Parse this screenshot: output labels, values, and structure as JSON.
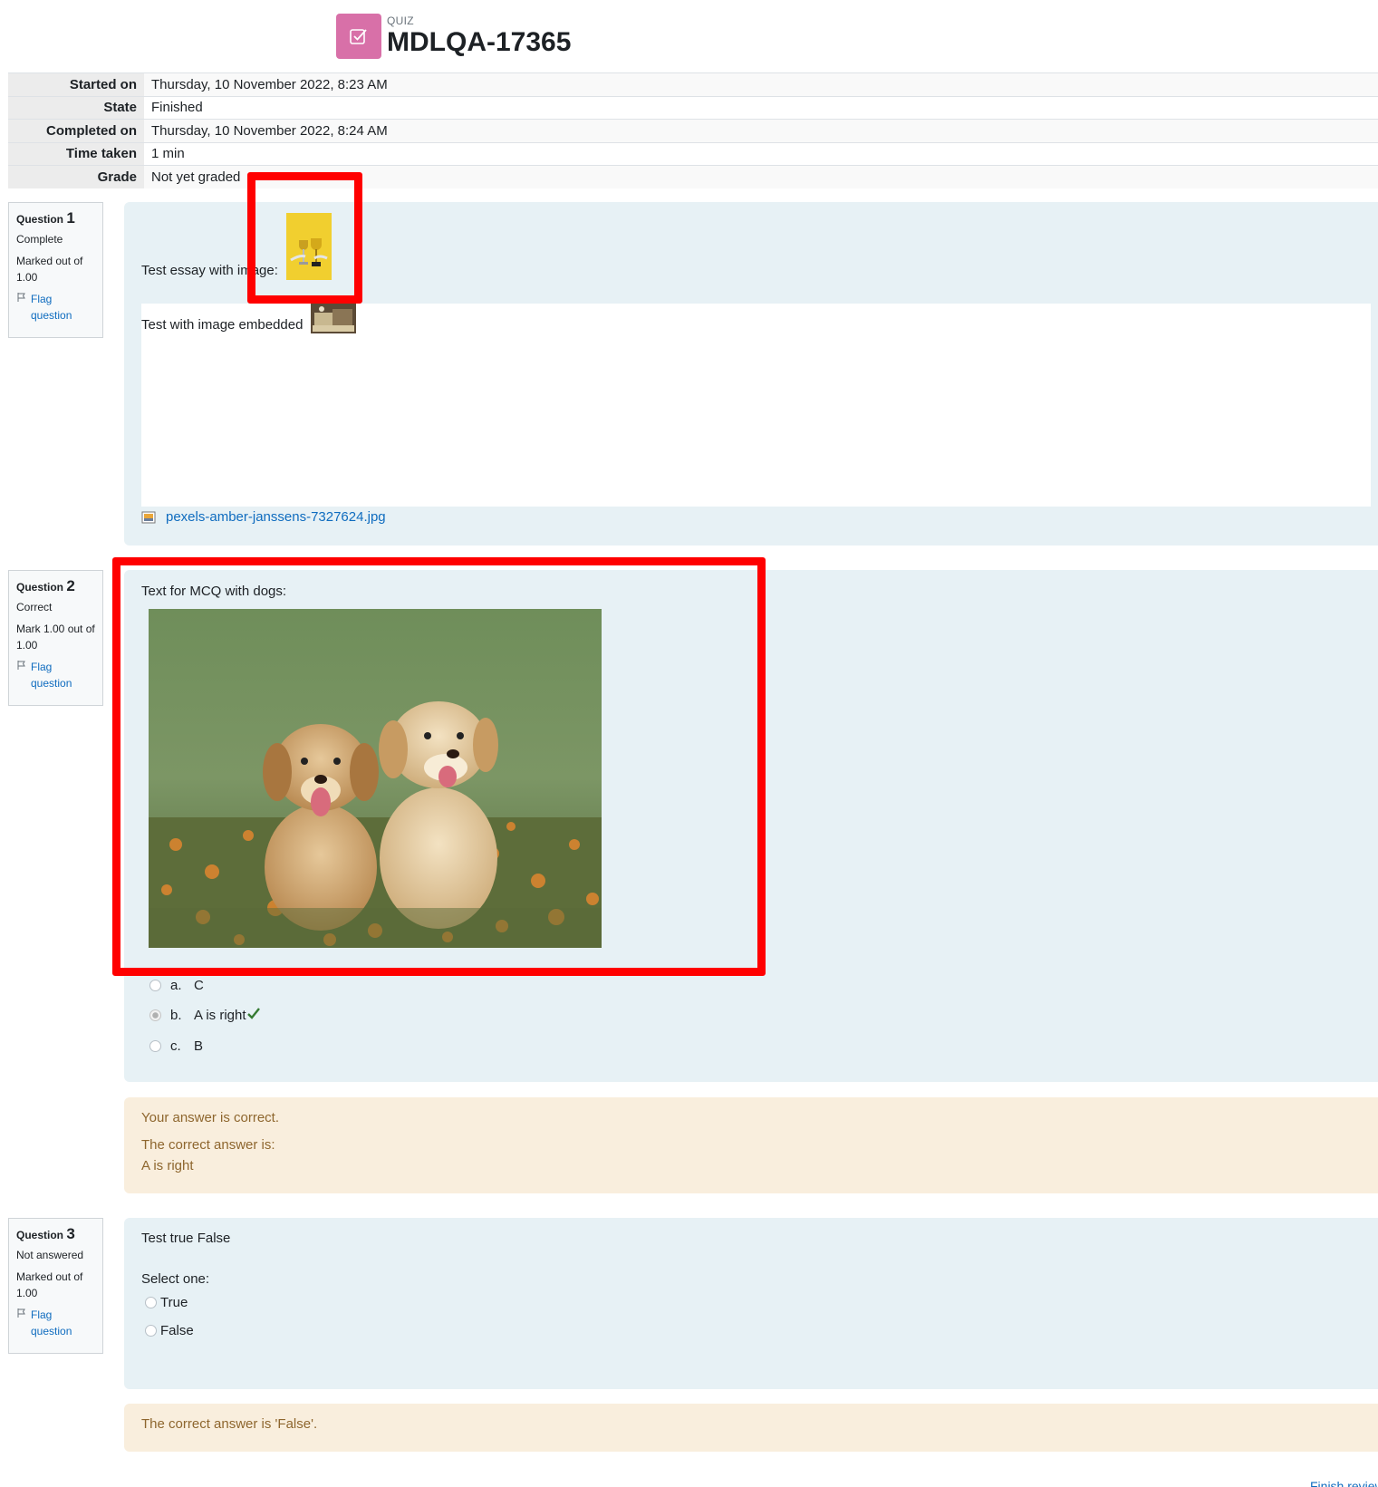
{
  "header": {
    "module_label": "QUIZ",
    "title": "MDLQA-17365",
    "icon": "quiz-checkbox-icon",
    "icon_color": "#d870a8"
  },
  "summary": [
    {
      "label": "Started on",
      "value": "Thursday, 10 November 2022, 8:23 AM"
    },
    {
      "label": "State",
      "value": "Finished"
    },
    {
      "label": "Completed on",
      "value": "Thursday, 10 November 2022, 8:24 AM"
    },
    {
      "label": "Time taken",
      "value": "1 min"
    },
    {
      "label": "Grade",
      "value": "Not yet graded"
    }
  ],
  "questions": [
    {
      "label": "Question",
      "number": "1",
      "state": "Complete",
      "grade": "Marked out of 1.00",
      "flag": "Flag question",
      "text": "Test essay with image:",
      "answer_text": "Test with image embedded",
      "attachment": "pexels-amber-janssens-7327624.jpg"
    },
    {
      "label": "Question",
      "number": "2",
      "state": "Correct",
      "grade": "Mark 1.00 out of 1.00",
      "flag": "Flag question",
      "text": "Text for MCQ with dogs:",
      "options": [
        {
          "letter": "a.",
          "text": "C",
          "selected": false
        },
        {
          "letter": "b.",
          "text": "A is right",
          "selected": true
        },
        {
          "letter": "c.",
          "text": "B",
          "selected": false
        }
      ],
      "feedback": "Your answer is correct.",
      "right_answer_label": "The correct answer is:",
      "right_answer": "A is right"
    },
    {
      "label": "Question",
      "number": "3",
      "state": "Not answered",
      "grade": "Marked out of 1.00",
      "flag": "Flag question",
      "text": "Test true False",
      "prompt": "Select one:",
      "options": [
        {
          "text": "True",
          "selected": false
        },
        {
          "text": "False",
          "selected": false
        }
      ],
      "right_answer": "The correct answer is 'False'."
    }
  ],
  "footer": {
    "finish_review": "Finish review"
  }
}
